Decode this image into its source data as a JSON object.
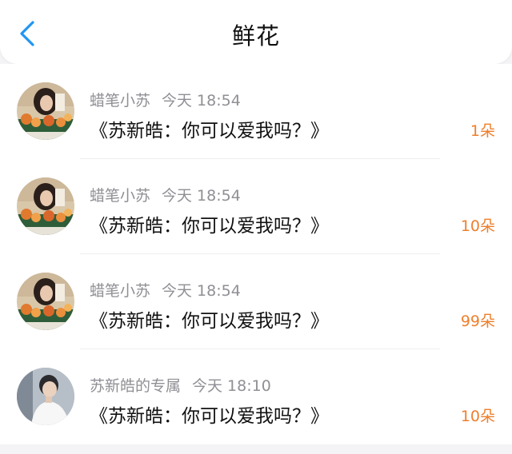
{
  "header": {
    "title": "鲜花",
    "back_icon": "chevron-left-icon"
  },
  "colors": {
    "accent": "#2196f3",
    "count": "#ee7f2d",
    "meta": "#8f8f95"
  },
  "items": [
    {
      "sender": "蜡笔小苏",
      "time": "今天 18:54",
      "message": "《苏新皓：你可以爱我吗？》",
      "count": "1朵",
      "avatar": "avatar-girl-flowers"
    },
    {
      "sender": "蜡笔小苏",
      "time": "今天 18:54",
      "message": "《苏新皓：你可以爱我吗？》",
      "count": "10朵",
      "avatar": "avatar-girl-flowers"
    },
    {
      "sender": "蜡笔小苏",
      "time": "今天 18:54",
      "message": "《苏新皓：你可以爱我吗？》",
      "count": "99朵",
      "avatar": "avatar-girl-flowers"
    },
    {
      "sender": "苏新皓的专属",
      "time": "今天 18:10",
      "message": "《苏新皓：你可以爱我吗？》",
      "count": "10朵",
      "avatar": "avatar-boy-white-shirt"
    }
  ]
}
